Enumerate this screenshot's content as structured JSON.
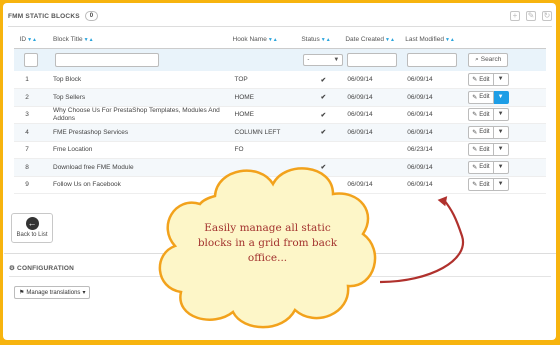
{
  "panel": {
    "title": "FMM STATIC BLOCKS",
    "count": "0",
    "icons": [
      "plus-icon",
      "edit-icon",
      "refresh-icon"
    ]
  },
  "columns": {
    "id": "ID",
    "block_title": "Block Title",
    "hook_name": "Hook Name",
    "status": "Status",
    "date_created": "Date Created",
    "last_modified": "Last Modified",
    "sort_glyph": "▼▲"
  },
  "filter": {
    "status_value": "-",
    "search_label": "Search"
  },
  "rows": [
    {
      "id": "1",
      "title": "Top Block",
      "hook": "TOP",
      "status": "✔",
      "created": "06/09/14",
      "modified": "06/09/14",
      "edit": "Edit"
    },
    {
      "id": "2",
      "title": "Top Sellers",
      "hook": "HOME",
      "status": "✔",
      "created": "06/09/14",
      "modified": "06/09/14",
      "edit": "Edit"
    },
    {
      "id": "3",
      "title": "Why Choose Us For PrestaShop Templates, Modules And Addons",
      "hook": "HOME",
      "status": "✔",
      "created": "06/09/14",
      "modified": "06/09/14",
      "edit": "Edit"
    },
    {
      "id": "4",
      "title": "FME Prestashop Services",
      "hook": "COLUMN LEFT",
      "status": "✔",
      "created": "06/09/14",
      "modified": "06/09/14",
      "edit": "Edit"
    },
    {
      "id": "7",
      "title": "Fme Location",
      "hook": "FO",
      "status": "",
      "created": "",
      "modified": "06/23/14",
      "edit": "Edit"
    },
    {
      "id": "8",
      "title": "Download free FME Module",
      "hook": "",
      "status": "✔",
      "created": "",
      "modified": "06/09/14",
      "edit": "Edit"
    },
    {
      "id": "9",
      "title": "Follow Us on Facebook",
      "hook": "",
      "status": "",
      "created": "06/09/14",
      "modified": "06/09/14",
      "edit": "Edit"
    }
  ],
  "back_to_list": "Back to List",
  "configuration": {
    "title": "CONFIGURATION",
    "manage_translations": "Manage translations"
  },
  "callout": {
    "line1": "Easily manage all static",
    "line2": "blocks in a grid from back",
    "line3": "office..."
  },
  "colors": {
    "frame": "#f7b40f",
    "cloud_fill": "#fdf6c8",
    "cloud_stroke": "#f2a21c",
    "callout_text": "#a3332f",
    "accent": "#1e9ee6",
    "status_ok": "#3eaa3e"
  }
}
